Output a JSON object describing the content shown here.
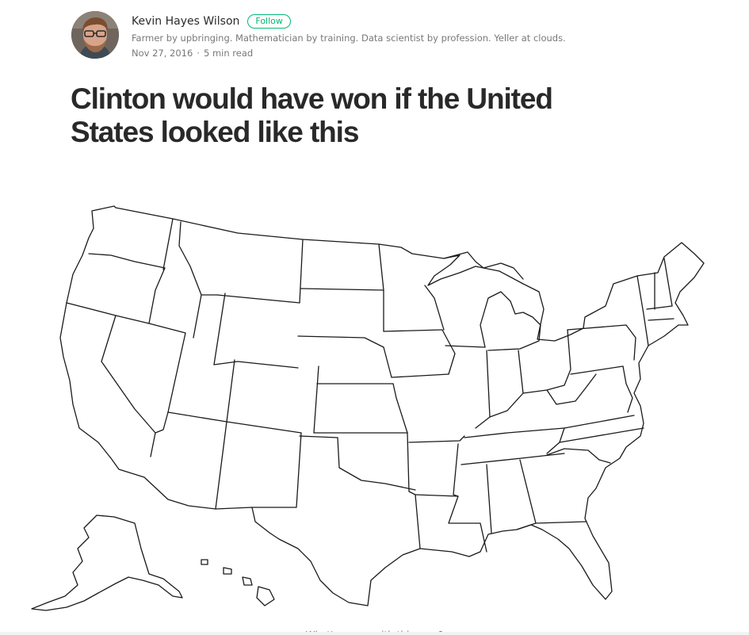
{
  "author": {
    "name": "Kevin Hayes Wilson",
    "follow_label": "Follow",
    "bio": "Farmer by upbringing. Mathematician by training. Data scientist by profession. Yeller at clouds.",
    "date": "Nov 27, 2016",
    "separator": "·",
    "read_time": "5 min read"
  },
  "article": {
    "title": "Clinton would have won if the United States looked like this"
  },
  "figure": {
    "caption": "What's wrong with this map?"
  },
  "colors": {
    "follow_accent": "#02b875",
    "map_stroke": "#1a1a1a",
    "map_fill": "#ffffff"
  }
}
